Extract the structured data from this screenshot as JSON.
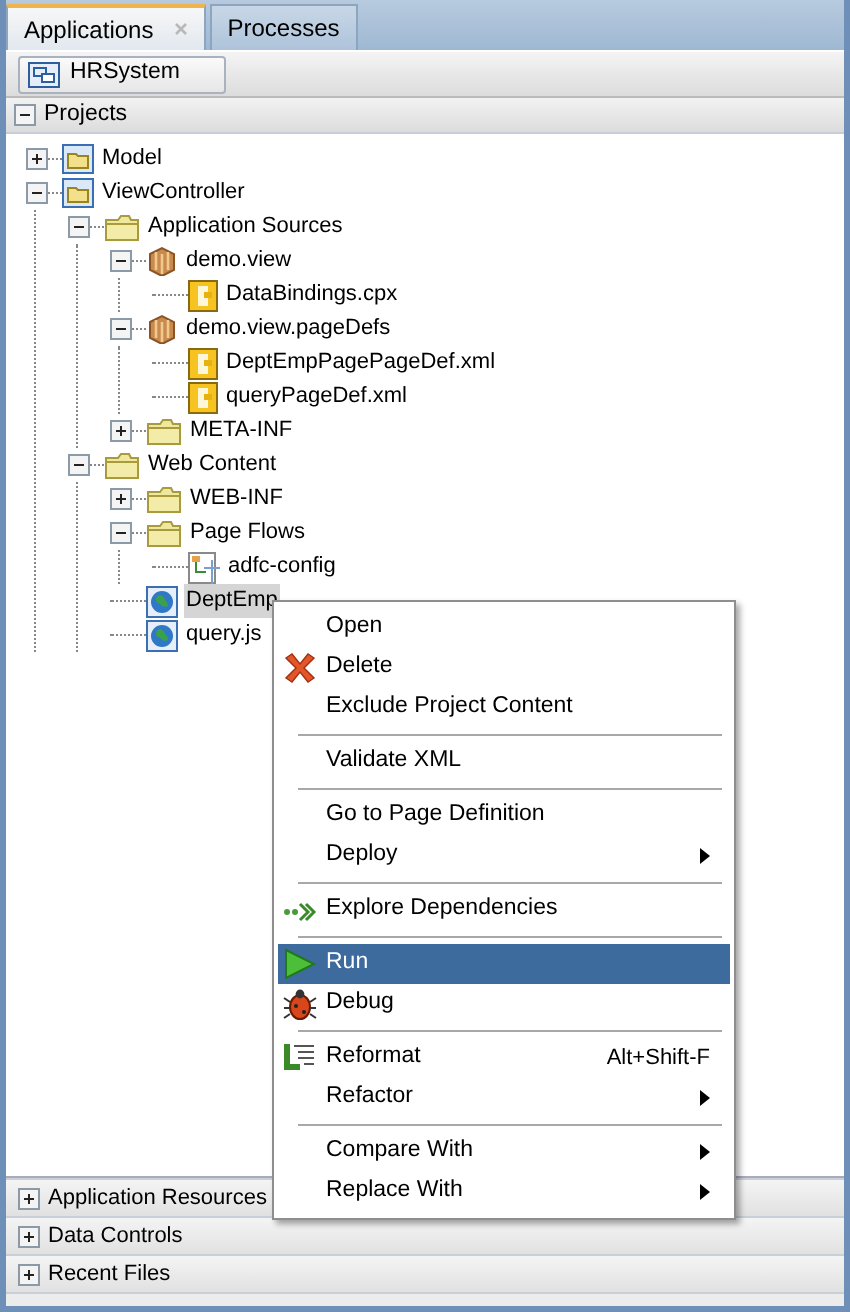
{
  "tabs": [
    {
      "label": "Applications",
      "selected": true,
      "closable": true
    },
    {
      "label": "Processes",
      "selected": false,
      "closable": false
    }
  ],
  "application_selector": {
    "label": "HRSystem"
  },
  "projects": {
    "title": "Projects",
    "expanded": true,
    "tree": [
      {
        "label": "Model",
        "kind": "project",
        "expanded": false,
        "selected": false
      },
      {
        "label": "ViewController",
        "kind": "project",
        "expanded": true,
        "selected": false,
        "children": [
          {
            "label": "Application Sources",
            "kind": "folder",
            "expanded": true,
            "selected": false,
            "children": [
              {
                "label": "demo.view",
                "kind": "package",
                "expanded": true,
                "selected": false,
                "children": [
                  {
                    "label": "DataBindings.cpx",
                    "kind": "xml",
                    "selected": false
                  }
                ]
              },
              {
                "label": "demo.view.pageDefs",
                "kind": "package",
                "expanded": true,
                "selected": false,
                "children": [
                  {
                    "label": "DeptEmpPagePageDef.xml",
                    "kind": "xml",
                    "selected": false
                  },
                  {
                    "label": "queryPageDef.xml",
                    "kind": "xml",
                    "selected": false
                  }
                ]
              },
              {
                "label": "META-INF",
                "kind": "folder",
                "expanded": false,
                "selected": false
              }
            ]
          },
          {
            "label": "Web Content",
            "kind": "folder",
            "expanded": true,
            "selected": false,
            "children": [
              {
                "label": "WEB-INF",
                "kind": "folder",
                "expanded": false,
                "selected": false
              },
              {
                "label": "Page Flows",
                "kind": "folder",
                "expanded": true,
                "selected": false,
                "children": [
                  {
                    "label": "adfc-config",
                    "kind": "diagram",
                    "selected": false
                  }
                ]
              },
              {
                "label": "DeptEmp",
                "kind": "page",
                "selected": true
              },
              {
                "label": "query.js",
                "kind": "page",
                "selected": false
              }
            ]
          }
        ]
      }
    ]
  },
  "context_menu": {
    "groups": [
      [
        {
          "label": "Open",
          "kind": "plain",
          "submenu": false,
          "selected": false
        },
        {
          "label": "Delete",
          "kind": "delete",
          "submenu": false,
          "selected": false
        },
        {
          "label": "Exclude Project Content",
          "kind": "plain",
          "submenu": false,
          "selected": false
        }
      ],
      [
        {
          "label": "Validate XML",
          "kind": "plain",
          "submenu": false,
          "selected": false
        }
      ],
      [
        {
          "label": "Go to Page Definition",
          "kind": "plain",
          "submenu": false,
          "selected": false
        },
        {
          "label": "Deploy",
          "kind": "plain",
          "submenu": true,
          "selected": false
        }
      ],
      [
        {
          "label": "Explore Dependencies",
          "kind": "explore",
          "submenu": false,
          "selected": false
        }
      ],
      [
        {
          "label": "Run",
          "kind": "run",
          "submenu": false,
          "selected": true
        },
        {
          "label": "Debug",
          "kind": "debug",
          "submenu": false,
          "selected": false
        }
      ],
      [
        {
          "label": "Reformat",
          "kind": "reformat",
          "shortcut": "Alt+Shift-F",
          "submenu": false,
          "selected": false
        },
        {
          "label": "Refactor",
          "kind": "plain",
          "submenu": true,
          "selected": false
        }
      ],
      [
        {
          "label": "Compare With",
          "kind": "plain",
          "submenu": true,
          "selected": false
        },
        {
          "label": "Replace With",
          "kind": "plain",
          "submenu": true,
          "selected": false
        }
      ]
    ]
  },
  "collapsed_panels": [
    {
      "title": "Application Resources",
      "expanded": false
    },
    {
      "title": "Data Controls",
      "expanded": false
    },
    {
      "title": "Recent Files",
      "expanded": false
    }
  ]
}
